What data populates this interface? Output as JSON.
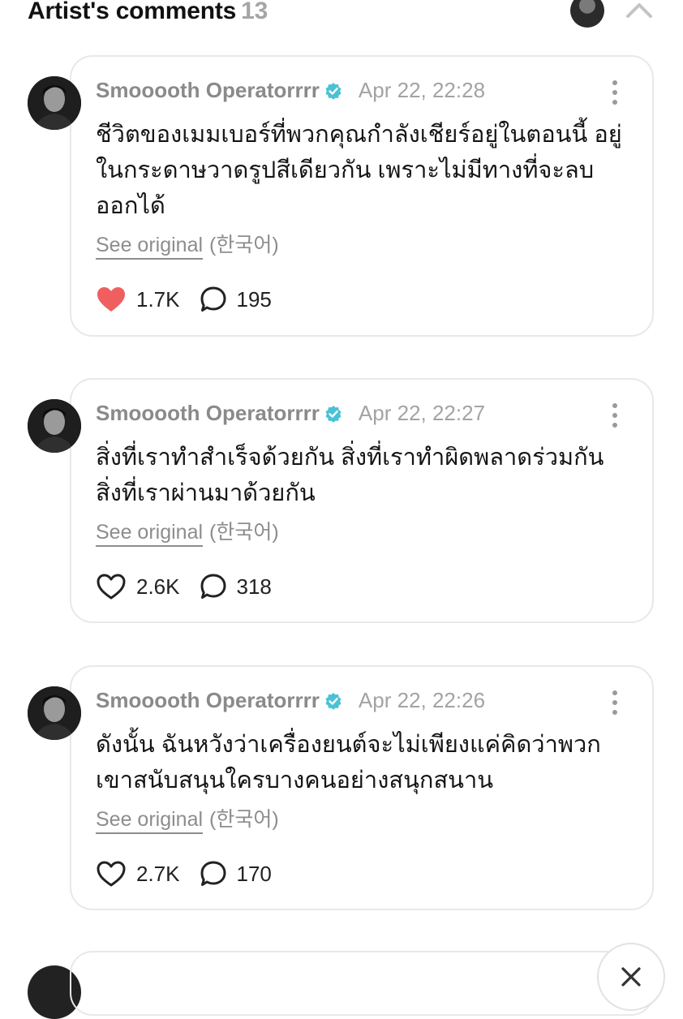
{
  "header": {
    "title": "Artist's comments",
    "count": "13"
  },
  "comments": [
    {
      "author": "Smooooth Operatorrrr",
      "time": "Apr 22, 22:28",
      "text": "ชีวิตของเมมเบอร์ที่พวกคุณกำลังเชียร์อยู่ในตอนนี้ อยู่ในกระดาษวาดรูปสีเดียวกัน เพราะไม่มีทางที่จะลบออกได้",
      "see_original": "See original",
      "language": "(한국어)",
      "likes": "1.7K",
      "liked": true,
      "replies": "195"
    },
    {
      "author": "Smooooth Operatorrrr",
      "time": "Apr 22, 22:27",
      "text": "สิ่งที่เราทำสำเร็จด้วยกัน สิ่งที่เราทำผิดพลาดร่วมกัน สิ่งที่เราผ่านมาด้วยกัน",
      "see_original": "See original",
      "language": "(한국어)",
      "likes": "2.6K",
      "liked": false,
      "replies": "318"
    },
    {
      "author": "Smooooth Operatorrrr",
      "time": "Apr 22, 22:26",
      "text": "ดังนั้น ฉันหวังว่าเครื่องยนต์จะไม่เพียงแค่คิดว่าพวกเขาสนับสนุนใครบางคนอย่างสนุกสนาน",
      "see_original": "See original",
      "language": "(한국어)",
      "likes": "2.7K",
      "liked": false,
      "replies": "170"
    }
  ],
  "colors": {
    "like_active": "#ef5f5f",
    "verified": "#48c2d6",
    "card_border": "#e8e8e8"
  },
  "icons": {
    "collapse": "chevron-up-icon",
    "more": "more-vertical-icon",
    "like": "heart-icon",
    "reply": "speech-bubble-icon",
    "verified": "verified-badge-icon",
    "close": "close-icon"
  }
}
